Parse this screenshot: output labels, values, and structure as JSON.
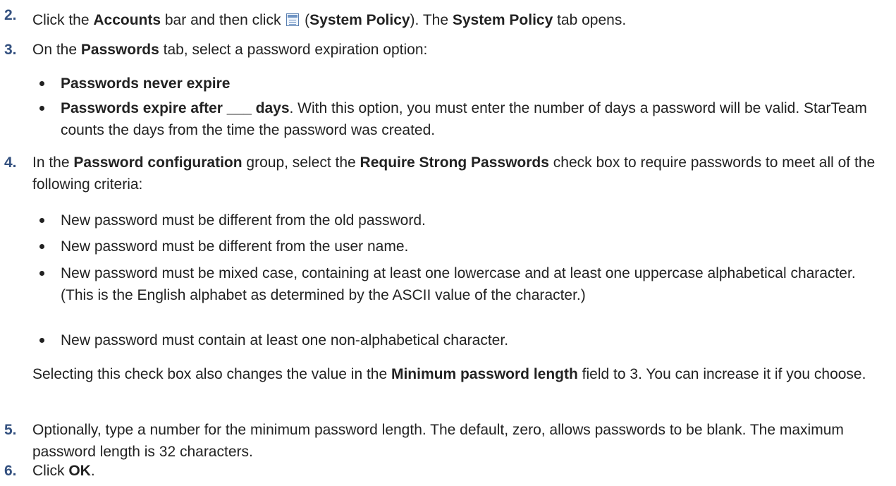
{
  "step2": {
    "number": "2.",
    "t1": "Click the ",
    "b1": "Accounts",
    "t2": " bar and then click ",
    "icon": "system-policy-icon",
    "t3": " (",
    "b2": "System Policy",
    "t4": "). The ",
    "b3": "System Policy",
    "t5": " tab opens."
  },
  "step3": {
    "number": "3.",
    "t1": "On the ",
    "b1": "Passwords",
    "t2": " tab, select a password expiration option:",
    "bullets": [
      {
        "bold": "Passwords never expire",
        "text": ""
      },
      {
        "bold": "Passwords expire after ___ days",
        "text": ". With this option, you must enter the number of days a password will be valid. StarTeam counts the days from the time the password was created."
      }
    ]
  },
  "step4": {
    "number": "4.",
    "t1": "In the ",
    "b1": "Password configuration",
    "t2": " group, select the ",
    "b2": "Require Strong Passwords",
    "t3": " check box to require passwords to meet all of the following criteria:",
    "bullets": [
      "New password must be different from the old password.",
      "New password must be different from the user name.",
      "New password must be mixed case, containing at least one lowercase and at least one uppercase alphabetical character. (This is the English alphabet as determined by the ASCII value of the character.)",
      "New password must contain at least one non-alphabetical character."
    ],
    "note_t1": "Selecting this check box also changes the value in the ",
    "note_b1": "Minimum password length",
    "note_t2": " field to 3. You can increase it if you choose."
  },
  "step5": {
    "number": "5.",
    "text": "Optionally, type a number for the minimum password length. The default, zero, allows passwords to be blank. The maximum password length is 32 characters."
  },
  "step6": {
    "number": "6.",
    "t1": "Click ",
    "b1": "OK",
    "t2": "."
  },
  "colors": {
    "step_number": "#33507f",
    "text": "#222222",
    "icon_border": "#5a7fb0"
  }
}
